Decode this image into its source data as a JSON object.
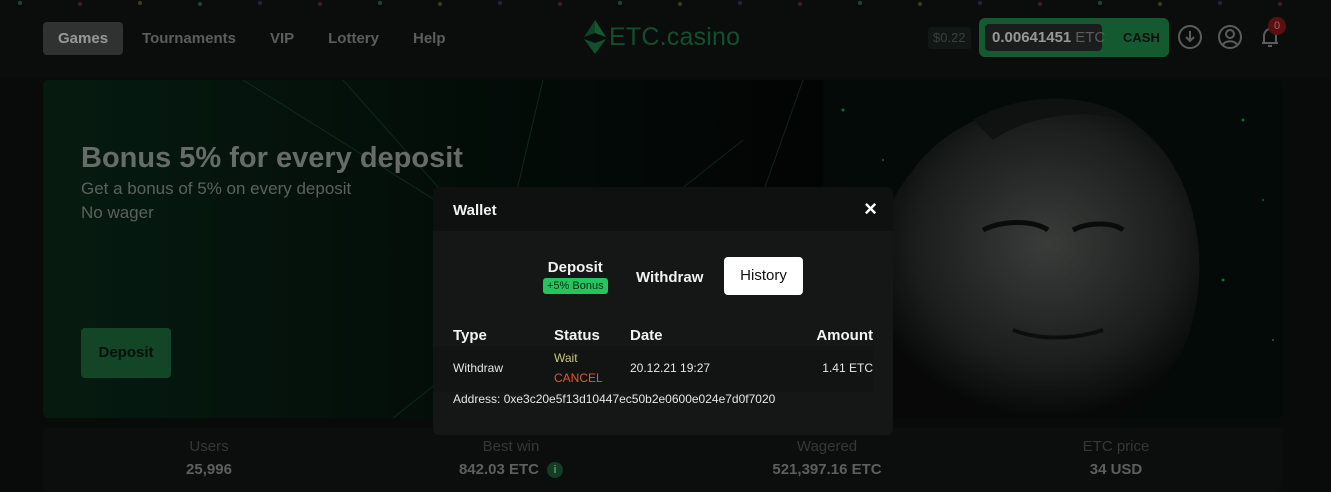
{
  "nav": {
    "items": [
      "Games",
      "Tournaments",
      "VIP",
      "Lottery",
      "Help"
    ],
    "active": "Games"
  },
  "logo": {
    "text": "ETC.casino",
    "accent": "#1c7b45"
  },
  "header": {
    "usd_value": "$0.22",
    "balance": "0.00641451",
    "currency": "ETC",
    "cash_label": "CASH",
    "notifications_count": "0",
    "icons": [
      "download-icon",
      "user-icon",
      "bell-icon"
    ]
  },
  "banner": {
    "title": "Bonus 5% for every deposit",
    "subtitle_line1": "Get a bonus of 5% on every deposit",
    "subtitle_line2": "No wager",
    "button": "Deposit"
  },
  "stats": [
    {
      "label": "Users",
      "value": "25,996"
    },
    {
      "label": "Best win",
      "value": "842.03 ETC"
    },
    {
      "label": "Wagered",
      "value": "521,397.16 ETC"
    },
    {
      "label": "ETC price",
      "value": "34 USD"
    }
  ],
  "wallet": {
    "title": "Wallet",
    "close": "×",
    "tabs": {
      "deposit": "Deposit",
      "bonus": "+5% Bonus",
      "withdraw": "Withdraw",
      "history": "History"
    },
    "columns": {
      "type": "Type",
      "status": "Status",
      "date": "Date",
      "amount": "Amount"
    },
    "row": {
      "type": "Withdraw",
      "status": "Wait",
      "action": "CANCEL",
      "date": "20.12.21 19:27",
      "amount": "1.41 ETC",
      "address": "Address: 0xe3c20e5f13d10447ec50b2e0600e024e7d0f7020"
    }
  },
  "colors": {
    "brand_green": "#1f8a4c",
    "bonus_green": "#22c55e",
    "cancel_red": "#e4572e",
    "wait_yellow": "#c8c873"
  }
}
